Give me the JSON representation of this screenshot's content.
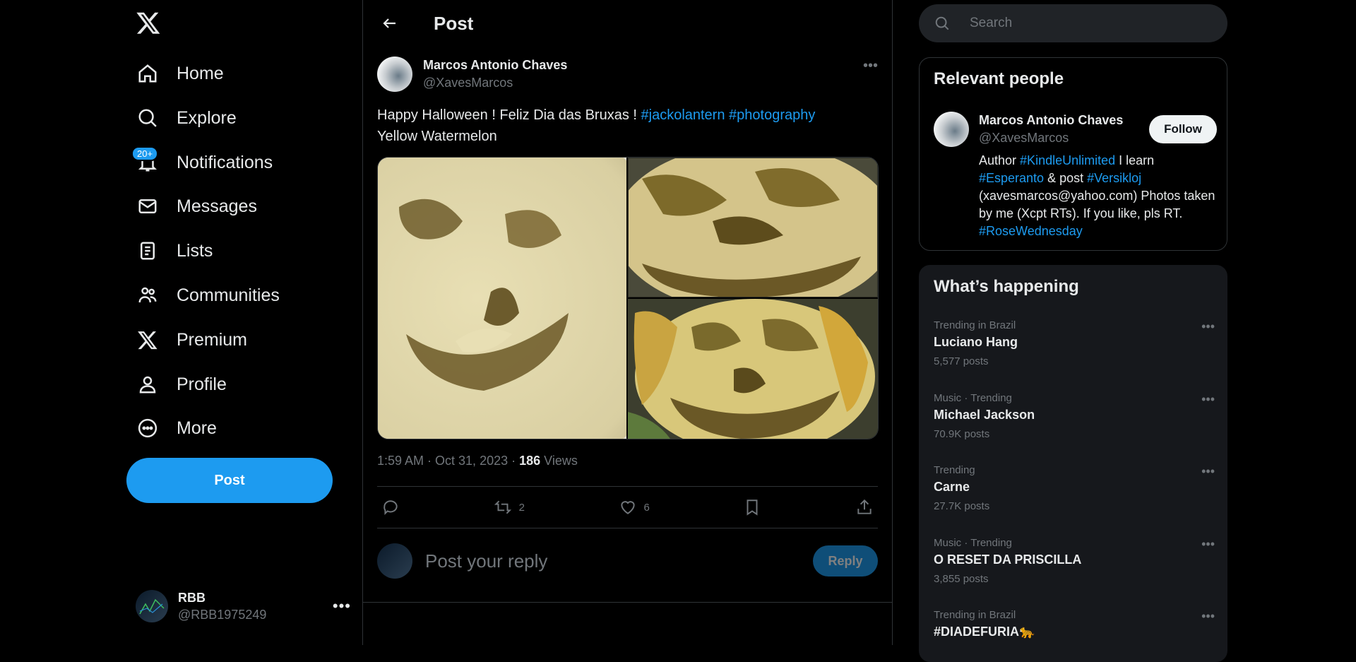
{
  "nav": {
    "items": [
      {
        "label": "Home",
        "icon": "home-icon"
      },
      {
        "label": "Explore",
        "icon": "search-icon"
      },
      {
        "label": "Notifications",
        "icon": "bell-icon",
        "badge": "20+"
      },
      {
        "label": "Messages",
        "icon": "envelope-icon"
      },
      {
        "label": "Lists",
        "icon": "list-icon"
      },
      {
        "label": "Communities",
        "icon": "people-icon"
      },
      {
        "label": "Premium",
        "icon": "x-logo-icon"
      },
      {
        "label": "Profile",
        "icon": "person-icon"
      },
      {
        "label": "More",
        "icon": "more-circle-icon"
      }
    ],
    "post_label": "Post",
    "account": {
      "name": "RBB",
      "handle": "@RBB1975249"
    }
  },
  "main": {
    "title": "Post",
    "tweet": {
      "author_name": "Marcos Antonio Chaves",
      "author_handle": "@XavesMarcos",
      "text_prefix": "Happy Halloween ! Feliz Dia das Bruxas ! ",
      "hashtag1": "#jackolantern",
      "hashtag2": "#photography",
      "text_line2": "Yellow Watermelon",
      "time": "1:59 AM · Oct 31, 2023 · ",
      "views_count": "186",
      "views_label": " Views",
      "retweets": "2",
      "likes": "6"
    },
    "reply_placeholder": "Post your reply",
    "reply_label": "Reply"
  },
  "right": {
    "search_placeholder": "Search",
    "relevant": {
      "title": "Relevant people",
      "name": "Marcos Antonio Chaves",
      "handle": "@XavesMarcos",
      "follow_label": "Follow",
      "bio_1": "Author ",
      "bio_tag1": "#KindleUnlimited",
      "bio_2": " I learn ",
      "bio_tag2": "#Esperanto",
      "bio_3": " & post ",
      "bio_tag3": "#Versikloj",
      "bio_4": " (xavesmarcos@yahoo.com) Photos taken by me (Xcpt RTs). If you like, pls RT. ",
      "bio_tag4": "#RoseWednesday"
    },
    "happening": {
      "title": "What’s happening",
      "trends": [
        {
          "context": "Trending in Brazil",
          "title": "Luciano Hang",
          "count": "5,577 posts"
        },
        {
          "context": "Music · Trending",
          "title": "Michael Jackson",
          "count": "70.9K posts"
        },
        {
          "context": "Trending",
          "title": "Carne",
          "count": "27.7K posts"
        },
        {
          "context": "Music · Trending",
          "title": "O RESET DA PRISCILLA",
          "count": "3,855 posts"
        },
        {
          "context": "Trending in Brazil",
          "title": "#DIADEFURIA🐆",
          "count": ""
        }
      ]
    }
  },
  "colors": {
    "accent": "#1d9bf0",
    "background": "#000000",
    "text": "#e7e9ea",
    "muted": "#71767b",
    "border": "#2f3336"
  }
}
